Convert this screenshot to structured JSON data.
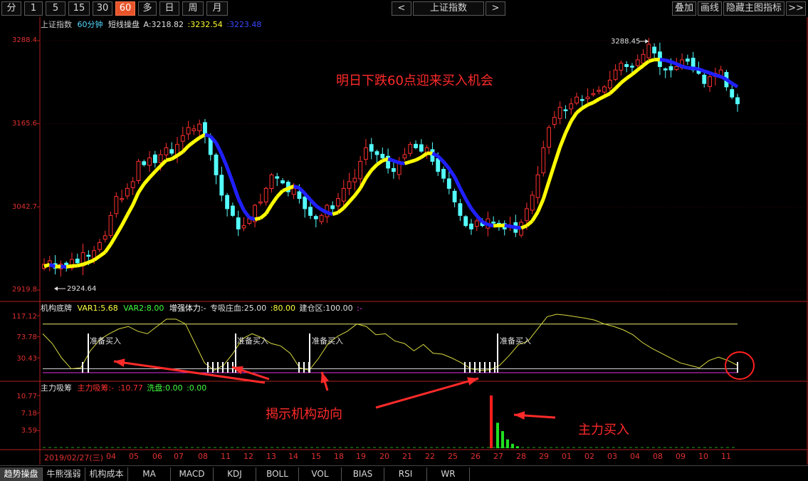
{
  "toolbar": {
    "periods": [
      "分",
      "1",
      "5",
      "15",
      "30",
      "60",
      "多",
      "日",
      "周",
      "月"
    ],
    "active_period": "60",
    "prev": "<",
    "index_name": "上证指数",
    "next": ">",
    "right_buttons": [
      "叠加",
      "画线",
      "隐藏主图指标",
      ">>"
    ]
  },
  "main_panel": {
    "title": "上证指数",
    "period": "60分钟",
    "indicator": "短线操盘",
    "a_label": "A:3218.82",
    "b_value": ":3232.54",
    "c_value": ":3223.48",
    "high_marker": "3288.45",
    "low_marker": "2924.64",
    "y_ticks": [
      "3288.4",
      "3165.6",
      "3042.7",
      "2919.8"
    ]
  },
  "mid_panel": {
    "name": "机构底牌",
    "var1": "VAR1:5.68",
    "var2": "VAR2:8.00",
    "zqtl": "增强体力:-",
    "zxzx": "专吸庄血:25.00",
    "v80": ":80.00",
    "jcq": "建仓区:100.00",
    "dash": ":-",
    "y_ticks": [
      "117.12",
      "73.78",
      "30.43"
    ],
    "signal_label": "准备买入"
  },
  "low_panel": {
    "name": "主力吸筹",
    "zlxc": "主力吸筹:-",
    "v1": ":10.77",
    "xp": "洗盘:0.00",
    "v2": ":0.00",
    "y_ticks": [
      "10.77",
      "7.18",
      "3.59"
    ]
  },
  "x_axis": {
    "labels": [
      "2019/02/27(三)",
      "04",
      "05",
      "06",
      "07",
      "08",
      "11",
      "12",
      "13",
      "14",
      "15",
      "18",
      "19",
      "20",
      "21",
      "22",
      "25",
      "26",
      "27",
      "28",
      "29",
      "01",
      "02",
      "03",
      "04",
      "08",
      "09",
      "10",
      "11"
    ]
  },
  "annotations": {
    "headline": "明日下跌60点迎来买入机会",
    "reveal": "揭示机构动向",
    "main_buy": "主力买入"
  },
  "bottom_tabs": [
    "趋势操盘",
    "牛熊强弱",
    "机构成本",
    "MA",
    "MACD",
    "KDJ",
    "BOLL",
    "VOL",
    "BIAS",
    "RSI",
    "WR"
  ],
  "active_bottom_tab": "趋势操盘",
  "colors": {
    "up": "#ff3030",
    "down": "#54ffff",
    "line_up": "#ffff00",
    "line_down": "#2020ff",
    "annotation": "#ff2a2a",
    "accent": "#e8542a"
  },
  "chart_data": [
    {
      "type": "candlestick",
      "title": "上证指数 60分钟",
      "ylim": [
        2919.8,
        3288.4
      ],
      "y_ticks": [
        3288.4,
        3165.6,
        3042.7,
        2919.8
      ],
      "high": 3288.45,
      "low": 2924.64,
      "closes": [
        2958,
        2963,
        2952,
        2958,
        2955,
        2965,
        2960,
        2975,
        2970,
        2978,
        2990,
        3000,
        3030,
        3058,
        3055,
        3070,
        3080,
        3110,
        3105,
        3115,
        3108,
        3120,
        3130,
        3122,
        3135,
        3148,
        3160,
        3158,
        3165,
        3150,
        3120,
        3090,
        3060,
        3040,
        3030,
        3010,
        3015,
        3025,
        3045,
        3050,
        3070,
        3090,
        3085,
        3078,
        3065,
        3070,
        3055,
        3040,
        3030,
        3025,
        3030,
        3045,
        3040,
        3055,
        3070,
        3080,
        3085,
        3110,
        3130,
        3125,
        3120,
        3115,
        3100,
        3095,
        3110,
        3120,
        3135,
        3130,
        3125,
        3130,
        3110,
        3095,
        3085,
        3070,
        3050,
        3030,
        3015,
        3010,
        3022,
        3015,
        3025,
        3020,
        3018,
        3010,
        3015,
        3005,
        3020,
        3040,
        3060,
        3090,
        3130,
        3160,
        3175,
        3190,
        3185,
        3195,
        3205,
        3200,
        3205,
        3210,
        3215,
        3220,
        3230,
        3245,
        3255,
        3250,
        3250,
        3260,
        3268,
        3283,
        3270,
        3250,
        3245,
        3245,
        3250,
        3260,
        3258,
        3245,
        3240,
        3225,
        3235,
        3240,
        3245,
        3220,
        3205,
        3195
      ]
    },
    {
      "type": "line",
      "title": "机构底牌",
      "ylim": [
        0,
        117.12
      ],
      "y_ticks": [
        117.12,
        73.78,
        30.43
      ],
      "series": [
        {
          "name": "VAR1",
          "values": [
            80,
            60,
            30,
            8,
            10,
            45,
            68,
            80,
            90,
            95,
            85,
            80,
            95,
            110,
            110,
            100,
            60,
            20,
            5,
            15,
            40,
            70,
            80,
            72,
            60,
            55,
            40,
            10,
            5,
            30,
            60,
            75,
            85,
            100,
            95,
            78,
            80,
            65,
            60,
            45,
            58,
            40,
            38,
            30,
            20,
            8,
            5,
            6,
            15,
            35,
            58,
            65,
            90,
            115,
            120,
            118,
            115,
            112,
            108,
            100,
            95,
            88,
            78,
            62,
            50,
            40,
            30,
            20,
            15,
            10,
            25,
            32,
            25,
            15
          ]
        }
      ],
      "reference_lines": [
        100,
        8,
        0
      ],
      "signals": [
        "准备买入",
        "准备买入",
        "准备买入",
        "准备买入"
      ]
    },
    {
      "type": "bar",
      "title": "主力吸筹",
      "ylim": [
        0,
        10.77
      ],
      "y_ticks": [
        10.77,
        7.18,
        3.59
      ],
      "series": [
        {
          "name": "主力吸筹",
          "values": [
            10.77
          ]
        },
        {
          "name": "洗盘",
          "values": [
            5.2,
            3.5,
            1.8,
            0.9,
            0.4
          ]
        }
      ]
    }
  ]
}
